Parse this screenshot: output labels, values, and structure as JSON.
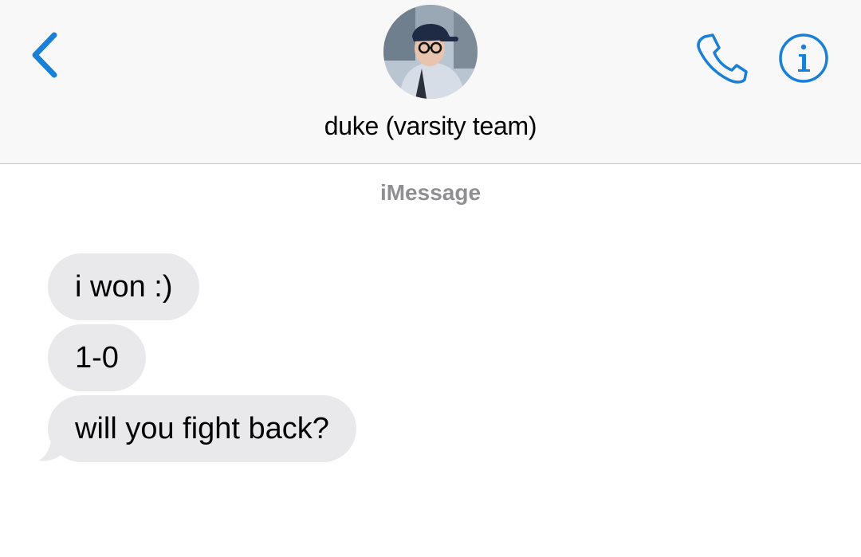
{
  "header": {
    "contact_name": "duke (varsity team)",
    "back_icon": "chevron-left-icon",
    "call_icon": "phone-icon",
    "info_icon": "info-icon",
    "accent_color": "#1a7fd6"
  },
  "conversation": {
    "service_label": "iMessage",
    "messages": [
      {
        "direction": "incoming",
        "text": "i won :)"
      },
      {
        "direction": "incoming",
        "text": "1-0"
      },
      {
        "direction": "incoming",
        "text": "will you fight back?"
      }
    ],
    "incoming_bubble_color": "#e9e9eb"
  }
}
